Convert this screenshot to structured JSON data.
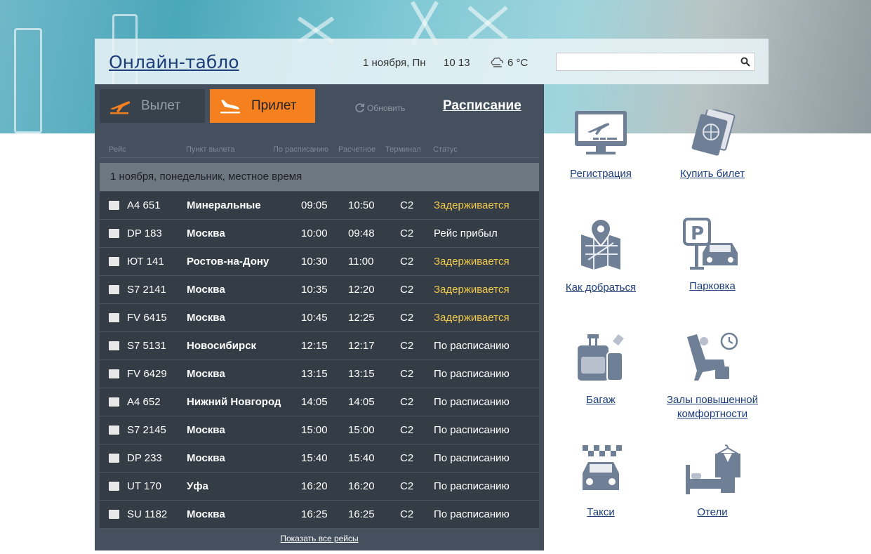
{
  "header": {
    "title": "Онлайн-табло",
    "date": "1 ноября, Пн",
    "time": "10  13",
    "temperature": "6 °C",
    "search": {
      "value": "",
      "placeholder": ""
    }
  },
  "board": {
    "tabs": {
      "departure": "Вылет",
      "arrival": "Прилет"
    },
    "refresh": "Обновить",
    "schedule": "Расписание",
    "columns": [
      "Рейс",
      "Пункт вылета",
      "По расписанию",
      "Расчетное",
      "Терминал",
      "Статус"
    ],
    "day": "1 ноября, понедельник, местное время",
    "show_all": "Показать все рейсы",
    "flights": [
      {
        "flight": "A4 651",
        "city": "Минеральные",
        "sched": "09:05",
        "calc": "10:50",
        "term": "C2",
        "status": "Задерживается",
        "delayed": true
      },
      {
        "flight": "DP 183",
        "city": "Москва",
        "sched": "10:00",
        "calc": "09:48",
        "term": "C2",
        "status": "Рейс прибыл",
        "delayed": false
      },
      {
        "flight": "ЮТ 141",
        "city": "Ростов-на-Дону",
        "sched": "10:30",
        "calc": "11:00",
        "term": "C2",
        "status": "Задерживается",
        "delayed": true
      },
      {
        "flight": "S7 2141",
        "city": "Москва",
        "sched": "10:35",
        "calc": "12:20",
        "term": "C2",
        "status": "Задерживается",
        "delayed": true
      },
      {
        "flight": "FV 6415",
        "city": "Москва",
        "sched": "10:45",
        "calc": "12:25",
        "term": "C2",
        "status": "Задерживается",
        "delayed": true
      },
      {
        "flight": "S7 5131",
        "city": "Новосибирск",
        "sched": "12:15",
        "calc": "12:17",
        "term": "C2",
        "status": "По расписанию",
        "delayed": false
      },
      {
        "flight": "FV 6429",
        "city": "Москва",
        "sched": "13:15",
        "calc": "13:15",
        "term": "C2",
        "status": "По расписанию",
        "delayed": false
      },
      {
        "flight": "A4 652",
        "city": "Нижний Новгород",
        "sched": "14:05",
        "calc": "14:05",
        "term": "C2",
        "status": "По расписанию",
        "delayed": false
      },
      {
        "flight": "S7 2145",
        "city": "Москва",
        "sched": "15:00",
        "calc": "15:00",
        "term": "C2",
        "status": "По расписанию",
        "delayed": false
      },
      {
        "flight": "DP 233",
        "city": "Москва",
        "sched": "15:40",
        "calc": "15:40",
        "term": "C2",
        "status": "По расписанию",
        "delayed": false
      },
      {
        "flight": "UT 170",
        "city": "Уфа",
        "sched": "16:20",
        "calc": "16:20",
        "term": "C2",
        "status": "По расписанию",
        "delayed": false
      },
      {
        "flight": "SU 1182",
        "city": "Москва",
        "sched": "16:25",
        "calc": "16:25",
        "term": "C2",
        "status": "По расписанию",
        "delayed": false
      }
    ]
  },
  "services": {
    "checkin": "Регистрация",
    "buy": "Купить билет",
    "route": "Как добраться",
    "parking": "Парковка",
    "baggage": "Багаж",
    "lounge_1": "Залы повышенной",
    "lounge_2": "комфортности",
    "taxi": "Такси",
    "hotels": "Отели"
  },
  "colors": {
    "accent": "#f4801f",
    "delayed": "#f2c94c",
    "link": "#1c3d7a",
    "board": "#44505d"
  }
}
